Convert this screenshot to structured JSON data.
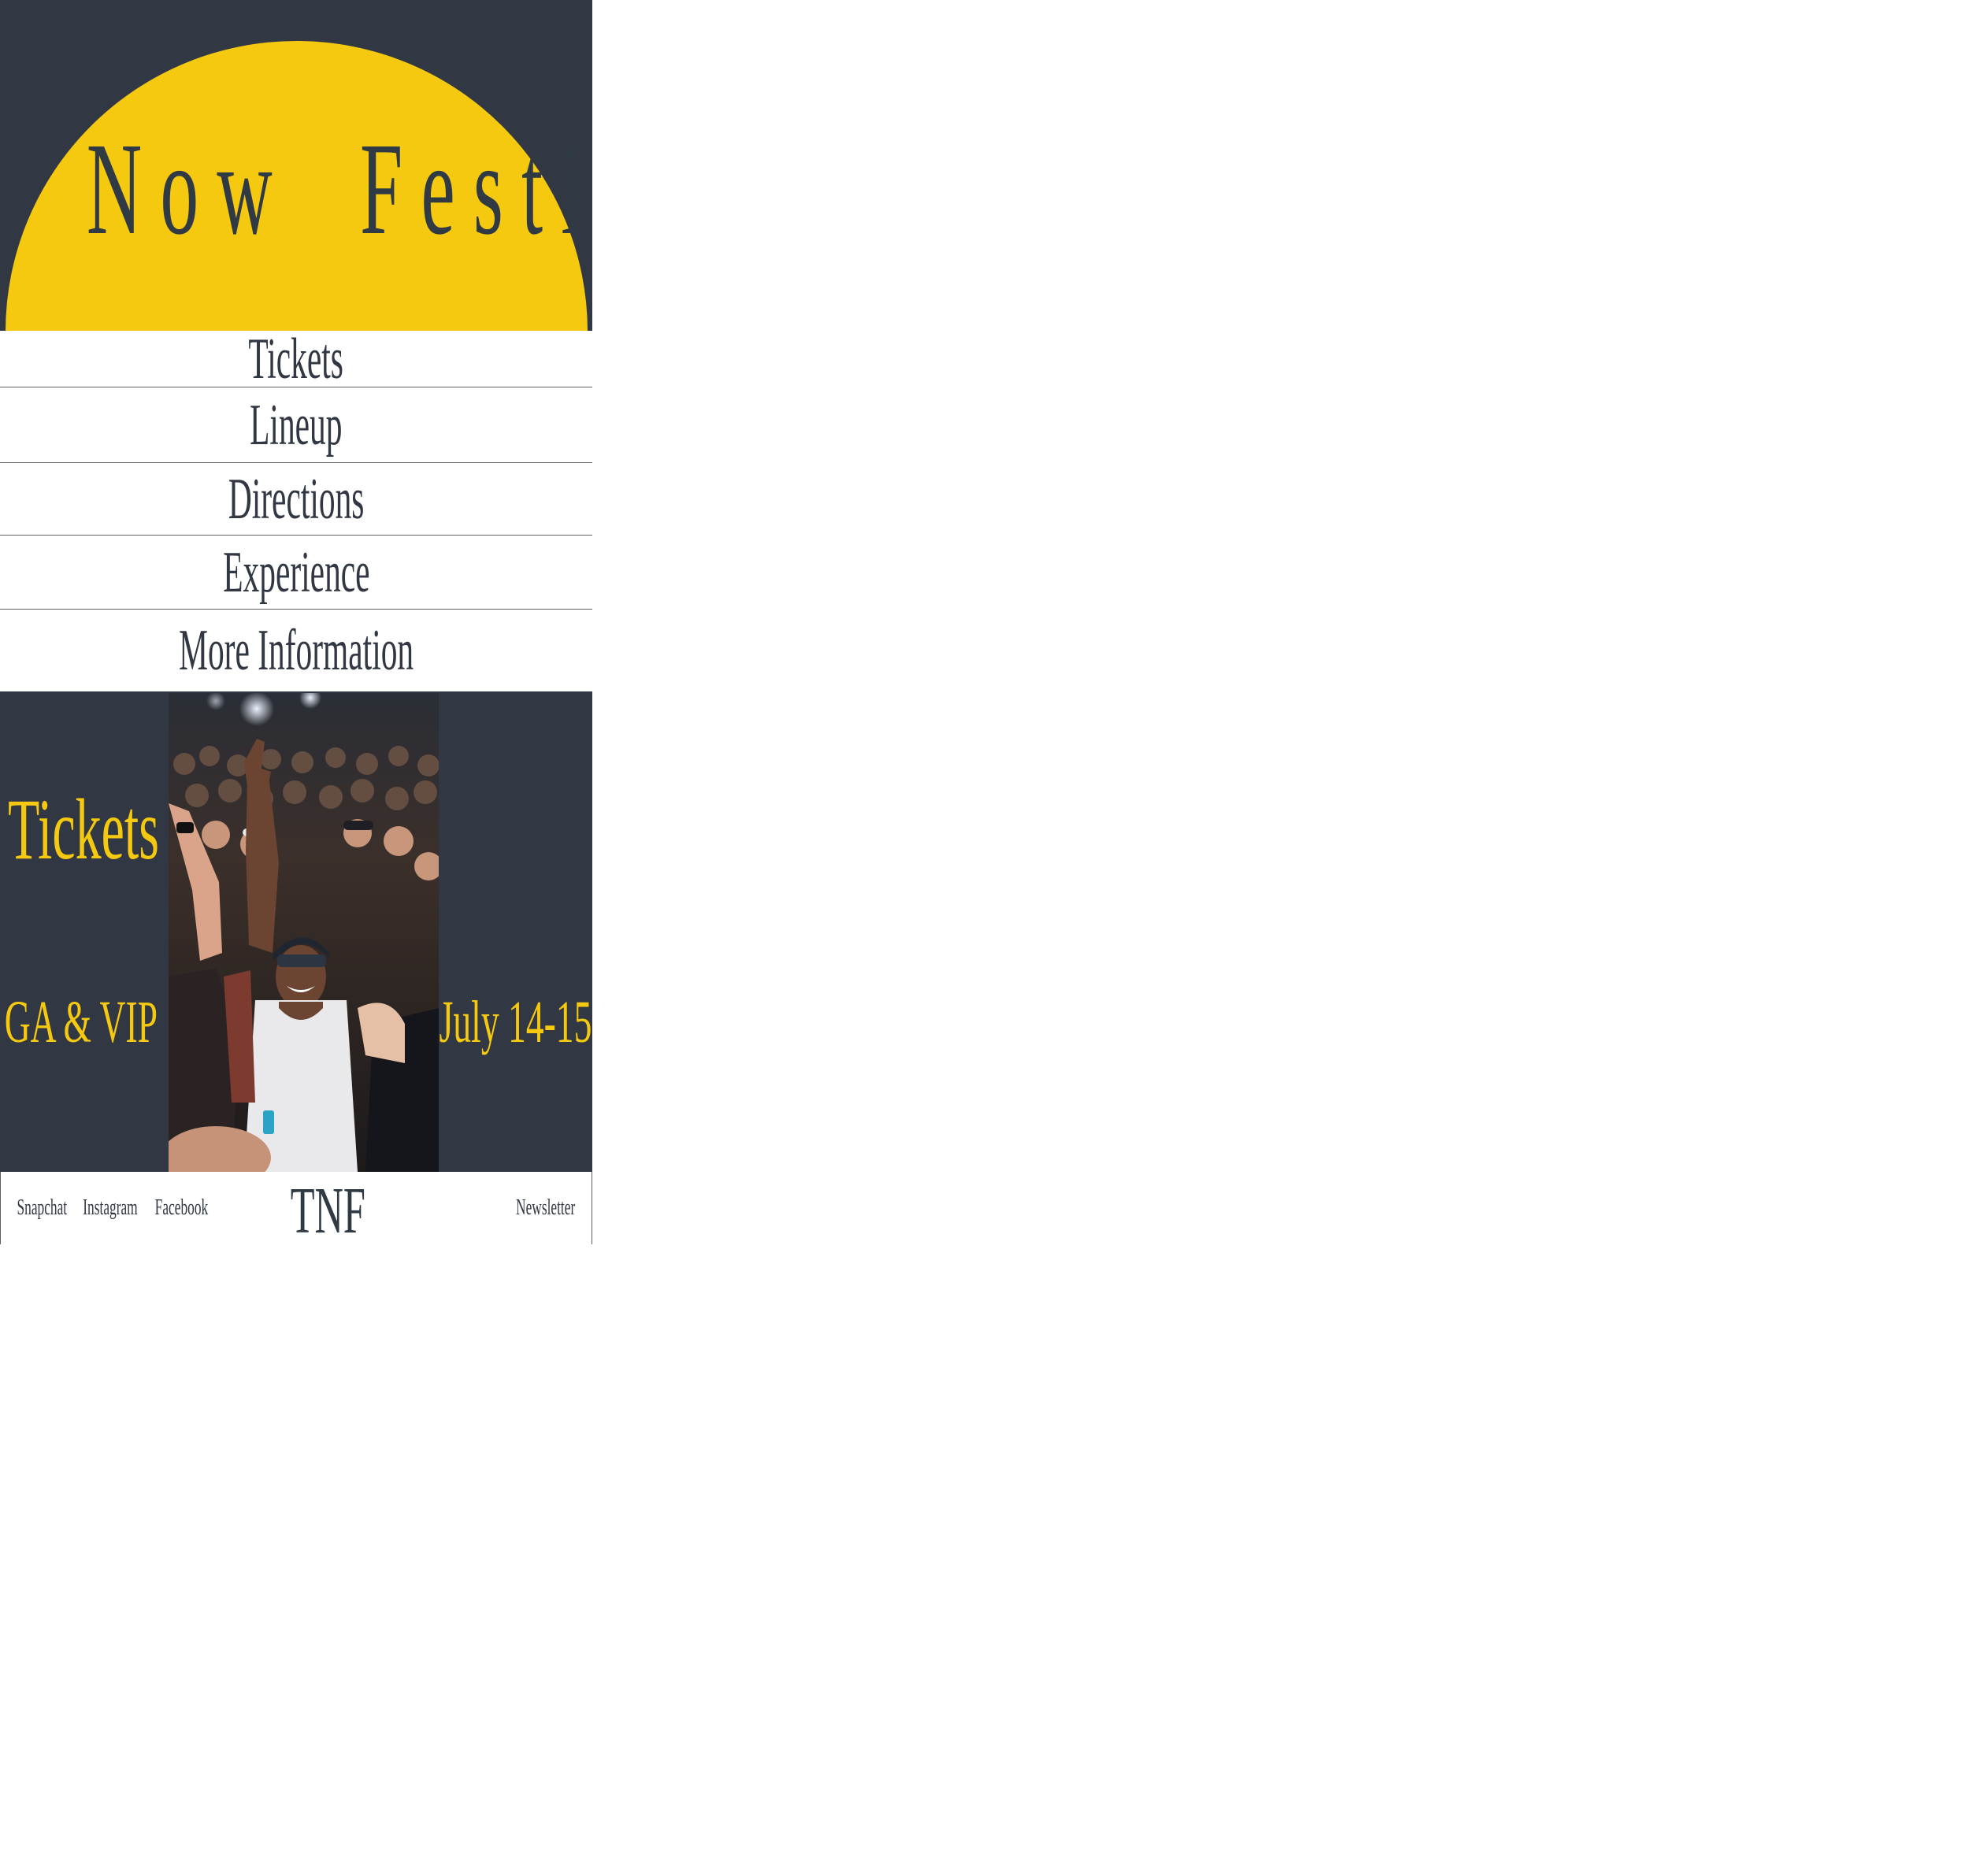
{
  "hero": {
    "title": "The Now Festival"
  },
  "nav": {
    "items": [
      {
        "label": "Tickets"
      },
      {
        "label": "Lineup"
      },
      {
        "label": "Directions"
      },
      {
        "label": "Experience"
      },
      {
        "label": "More Information"
      }
    ]
  },
  "promo": {
    "title": "Tickets",
    "ticket_types": "GA & VIP",
    "dates": "July 14-15",
    "image": "concert-crowd-photo"
  },
  "footer": {
    "links": [
      {
        "label": "Snapchat"
      },
      {
        "label": "Instagram"
      },
      {
        "label": "Facebook"
      }
    ],
    "logo": "TNF",
    "newsletter": "Newsletter"
  },
  "colors": {
    "navy": "#313844",
    "yellow": "#f5c90f",
    "title_text": "#2f3a45",
    "white": "#ffffff"
  }
}
